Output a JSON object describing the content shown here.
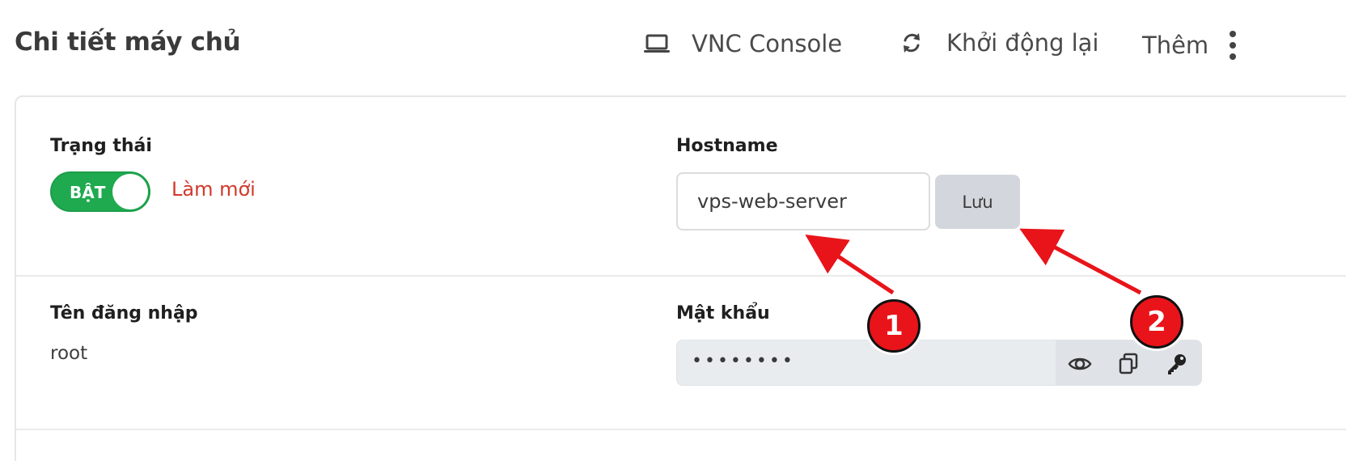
{
  "header": {
    "title": "Chi tiết máy chủ",
    "actions": {
      "vnc_label": "VNC Console",
      "reboot_label": "Khởi động lại",
      "more_label": "Thêm"
    }
  },
  "status": {
    "label": "Trạng thái",
    "toggle_text": "BẬT",
    "toggle_on": true,
    "refresh_label": "Làm mới"
  },
  "hostname": {
    "label": "Hostname",
    "value": "vps-web-server",
    "save_label": "Lưu"
  },
  "login": {
    "label": "Tên đăng nhập",
    "value": "root"
  },
  "password": {
    "label": "Mật khẩu",
    "mask": "••••••••",
    "actions": [
      "eye-icon",
      "copy-icon",
      "key-icon"
    ]
  },
  "annotations": {
    "callout_1": "1",
    "callout_2": "2",
    "color": "#e8141a"
  },
  "colors": {
    "toggle_on": "#1faa4f",
    "refresh_link": "#d0392b",
    "save_button_bg": "#d3d7dd"
  }
}
